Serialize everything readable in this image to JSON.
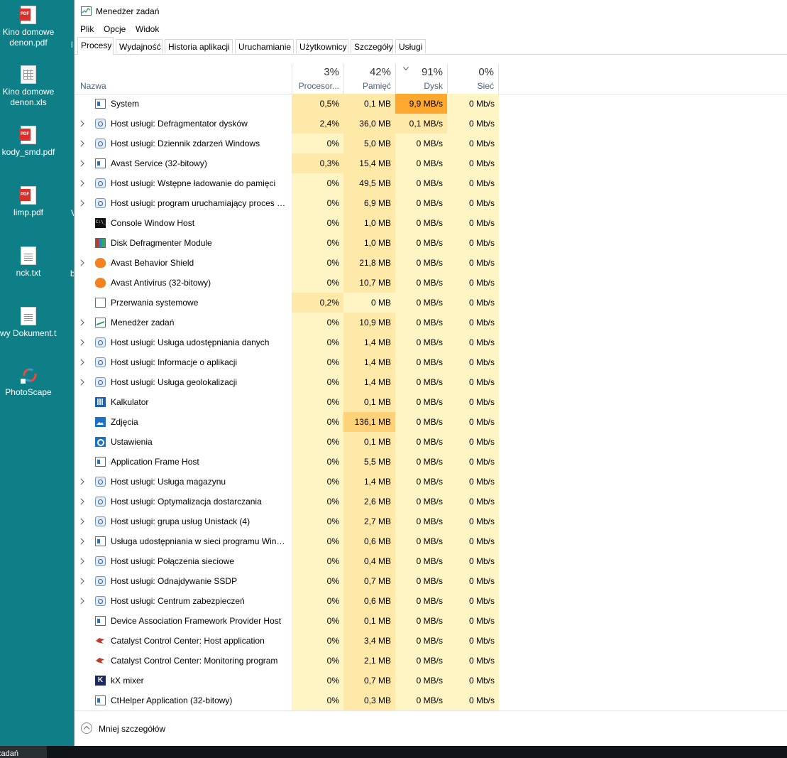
{
  "desktop": {
    "icons": [
      {
        "type": "pdf",
        "line1": "Kino domowe",
        "line2": "denon.pdf"
      },
      {
        "type": "xls",
        "line1": "Kino domowe",
        "line2": "denon.xls"
      },
      {
        "type": "pdf",
        "line1": "kody_smd.pdf",
        "line2": ""
      },
      {
        "type": "pdf",
        "line1": "limp.pdf",
        "line2": ""
      },
      {
        "type": "txt",
        "line1": "nck.txt",
        "line2": ""
      },
      {
        "type": "txt",
        "line1": "wy Dokument.txt",
        "line2": ""
      },
      {
        "type": "photoscape",
        "line1": "PhotoScape",
        "line2": ""
      }
    ],
    "taskbar_item": "zadań"
  },
  "window": {
    "title": "Menedżer zadań",
    "menu": [
      "Plik",
      "Opcje",
      "Widok"
    ],
    "tabs": [
      "Procesy",
      "Wydajność",
      "Historia aplikacji",
      "Uruchamianie",
      "Użytkownicy",
      "Szczegóły",
      "Usługi"
    ],
    "active_tab": "Procesy"
  },
  "header": {
    "name_label": "Nazwa",
    "columns": [
      {
        "pct": "3%",
        "label": "Procesor..."
      },
      {
        "pct": "42%",
        "label": "Pamięć"
      },
      {
        "pct": "91%",
        "label": "Dysk",
        "sorted": true
      },
      {
        "pct": "0%",
        "label": "Sieć"
      }
    ]
  },
  "processes": [
    {
      "name": "System",
      "icon": "app-icon",
      "expand": false,
      "cpu": "0,5%",
      "mem": "0,1 MB",
      "disk": "9,9 MB/s",
      "net": "0 Mb/s"
    },
    {
      "name": "Host usługi: Defragmentator dysków",
      "icon": "gear-icon",
      "expand": true,
      "cpu": "2,4%",
      "mem": "36,0 MB",
      "disk": "0,1 MB/s",
      "net": "0 Mb/s"
    },
    {
      "name": "Host usługi: Dziennik zdarzeń Windows",
      "icon": "gear-icon",
      "expand": true,
      "cpu": "0%",
      "mem": "5,0 MB",
      "disk": "0 MB/s",
      "net": "0 Mb/s"
    },
    {
      "name": "Avast Service (32-bitowy)",
      "icon": "app-icon",
      "expand": true,
      "cpu": "0,3%",
      "mem": "15,4 MB",
      "disk": "0 MB/s",
      "net": "0 Mb/s"
    },
    {
      "name": "Host usługi: Wstępne ładowanie do pamięci",
      "icon": "gear-icon",
      "expand": true,
      "cpu": "0%",
      "mem": "49,5 MB",
      "disk": "0 MB/s",
      "net": "0 Mb/s"
    },
    {
      "name": "Host usługi: program uruchamiający proces serwera DCOM",
      "icon": "gear-icon",
      "expand": true,
      "cpu": "0%",
      "mem": "6,9 MB",
      "disk": "0 MB/s",
      "net": "0 Mb/s"
    },
    {
      "name": "Console Window Host",
      "icon": "console-icon",
      "expand": false,
      "cpu": "0%",
      "mem": "1,0 MB",
      "disk": "0 MB/s",
      "net": "0 Mb/s"
    },
    {
      "name": "Disk Defragmenter Module",
      "icon": "defrag-icon",
      "expand": false,
      "cpu": "0%",
      "mem": "1,0 MB",
      "disk": "0 MB/s",
      "net": "0 Mb/s"
    },
    {
      "name": "Avast Behavior Shield",
      "icon": "avast-icon",
      "expand": true,
      "cpu": "0%",
      "mem": "21,8 MB",
      "disk": "0 MB/s",
      "net": "0 Mb/s"
    },
    {
      "name": "Avast Antivirus (32-bitowy)",
      "icon": "avast-icon",
      "expand": false,
      "cpu": "0%",
      "mem": "10,7 MB",
      "disk": "0 MB/s",
      "net": "0 Mb/s"
    },
    {
      "name": "Przerwania systemowe",
      "icon": "interrupt-icon",
      "expand": false,
      "cpu": "0,2%",
      "mem": "0 MB",
      "disk": "0 MB/s",
      "net": "0 Mb/s"
    },
    {
      "name": "Menedżer zadań",
      "icon": "task-manager-icon",
      "expand": true,
      "cpu": "0%",
      "mem": "10,9 MB",
      "disk": "0 MB/s",
      "net": "0 Mb/s"
    },
    {
      "name": "Host usługi: Usługa udostępniania danych",
      "icon": "gear-icon",
      "expand": true,
      "cpu": "0%",
      "mem": "1,4 MB",
      "disk": "0 MB/s",
      "net": "0 Mb/s"
    },
    {
      "name": "Host usługi: Informacje o aplikacji",
      "icon": "gear-icon",
      "expand": true,
      "cpu": "0%",
      "mem": "1,4 MB",
      "disk": "0 MB/s",
      "net": "0 Mb/s"
    },
    {
      "name": "Host usługi: Usługa geolokalizacji",
      "icon": "gear-icon",
      "expand": true,
      "cpu": "0%",
      "mem": "1,4 MB",
      "disk": "0 MB/s",
      "net": "0 Mb/s"
    },
    {
      "name": "Kalkulator",
      "icon": "calculator-icon",
      "expand": false,
      "cpu": "0%",
      "mem": "0,1 MB",
      "disk": "0 MB/s",
      "net": "0 Mb/s"
    },
    {
      "name": "Zdjęcia",
      "icon": "photos-icon",
      "expand": false,
      "cpu": "0%",
      "mem": "136,1 MB",
      "disk": "0 MB/s",
      "net": "0 Mb/s"
    },
    {
      "name": "Ustawienia",
      "icon": "settings-icon",
      "expand": false,
      "cpu": "0%",
      "mem": "0,1 MB",
      "disk": "0 MB/s",
      "net": "0 Mb/s"
    },
    {
      "name": "Application Frame Host",
      "icon": "app-icon",
      "expand": false,
      "cpu": "0%",
      "mem": "5,5 MB",
      "disk": "0 MB/s",
      "net": "0 Mb/s"
    },
    {
      "name": "Host usługi: Usługa magazynu",
      "icon": "gear-icon",
      "expand": true,
      "cpu": "0%",
      "mem": "1,4 MB",
      "disk": "0 MB/s",
      "net": "0 Mb/s"
    },
    {
      "name": "Host usługi: Optymalizacja dostarczania",
      "icon": "gear-icon",
      "expand": true,
      "cpu": "0%",
      "mem": "2,6 MB",
      "disk": "0 MB/s",
      "net": "0 Mb/s"
    },
    {
      "name": "Host usługi: grupa usług Unistack (4)",
      "icon": "gear-icon",
      "expand": true,
      "cpu": "0%",
      "mem": "2,7 MB",
      "disk": "0 MB/s",
      "net": "0 Mb/s"
    },
    {
      "name": "Usługa udostępniania w sieci programu Windows Media",
      "icon": "app-icon",
      "expand": true,
      "cpu": "0%",
      "mem": "0,6 MB",
      "disk": "0 MB/s",
      "net": "0 Mb/s"
    },
    {
      "name": "Host usługi: Połączenia sieciowe",
      "icon": "gear-icon",
      "expand": true,
      "cpu": "0%",
      "mem": "0,4 MB",
      "disk": "0 MB/s",
      "net": "0 Mb/s"
    },
    {
      "name": "Host usługi: Odnajdywanie SSDP",
      "icon": "gear-icon",
      "expand": true,
      "cpu": "0%",
      "mem": "0,7 MB",
      "disk": "0 MB/s",
      "net": "0 Mb/s"
    },
    {
      "name": "Host usługi: Centrum zabezpieczeń",
      "icon": "gear-icon",
      "expand": true,
      "cpu": "0%",
      "mem": "0,6 MB",
      "disk": "0 MB/s",
      "net": "0 Mb/s"
    },
    {
      "name": "Device Association Framework Provider Host",
      "icon": "app-icon",
      "expand": false,
      "cpu": "0%",
      "mem": "0,1 MB",
      "disk": "0 MB/s",
      "net": "0 Mb/s"
    },
    {
      "name": "Catalyst Control Center: Host application",
      "icon": "catalyst-icon",
      "expand": false,
      "cpu": "0%",
      "mem": "3,4 MB",
      "disk": "0 MB/s",
      "net": "0 Mb/s"
    },
    {
      "name": "Catalyst Control Center: Monitoring program",
      "icon": "catalyst-icon",
      "expand": false,
      "cpu": "0%",
      "mem": "2,1 MB",
      "disk": "0 MB/s",
      "net": "0 Mb/s"
    },
    {
      "name": "kX mixer",
      "icon": "kx-icon",
      "expand": false,
      "cpu": "0%",
      "mem": "0,7 MB",
      "disk": "0 MB/s",
      "net": "0 Mb/s"
    },
    {
      "name": "CtHelper Application (32-bitowy)",
      "icon": "app-icon",
      "expand": false,
      "cpu": "0%",
      "mem": "0,3 MB",
      "disk": "0 MB/s",
      "net": "0 Mb/s"
    }
  ],
  "footer": {
    "label": "Mniej szczegółów"
  },
  "colors": {
    "heat_light": "#fff4c4",
    "heat_medium": "#ffe9a8",
    "heat_strong": "#ffd279",
    "heat_hot": "#ffa830",
    "desktop_bg": "#0f7f87"
  }
}
